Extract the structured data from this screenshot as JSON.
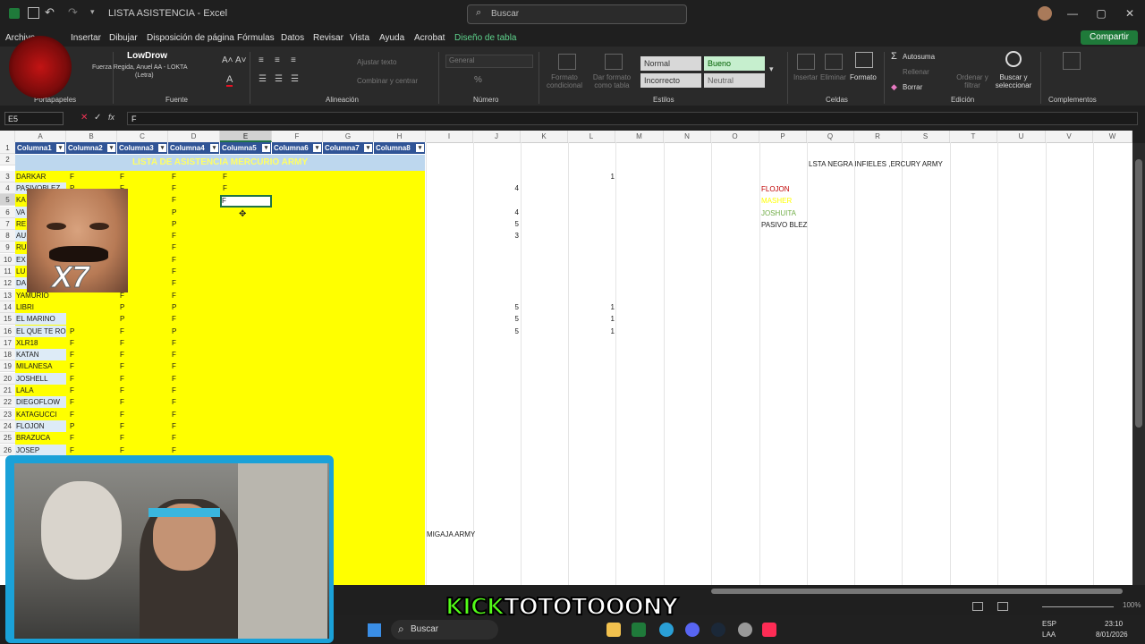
{
  "titlebar": {
    "file_title": "LISTA ASISTENCIA",
    "app_sep": "-",
    "app_name": "Excel",
    "search_placeholder": "Buscar"
  },
  "menu": {
    "items": [
      "Archivo",
      "Insertar",
      "Dibujar",
      "Disposición de página",
      "Fórmulas",
      "Datos",
      "Revisar",
      "Vista",
      "Ayuda",
      "Acrobat",
      "Diseño de tabla"
    ],
    "share_label": "Compartir"
  },
  "ribbon": {
    "groups": [
      "Portapapeles",
      "Fuente",
      "Alineación",
      "Número",
      "Estilos",
      "Celdas",
      "Edición",
      "Complementos"
    ],
    "music_title": "LowDrow",
    "music_subtitle": "Fuerza Regida, Anuel AA - LOKTA",
    "music_subtitle2": "(Letra)",
    "wrap_text": "Ajustar texto",
    "merge_center": "Combinar y centrar",
    "number_format": "General",
    "cond_format": "Formato condicional",
    "format_table": "Dar formato como tabla",
    "styles": {
      "normal": "Normal",
      "good": "Bueno",
      "bad": "Incorrecto",
      "neutral": "Neutral"
    },
    "insert": "Insertar",
    "delete": "Eliminar",
    "format": "Formato",
    "autosum": "Autosuma",
    "fill": "Rellenar",
    "clear": "Borrar",
    "sort_filter": "Ordenar y filtrar",
    "find_select": "Buscar y seleccionar"
  },
  "formula_bar": {
    "name_box": "E5",
    "formula": "F",
    "fx": "fx"
  },
  "columns": [
    "A",
    "B",
    "C",
    "D",
    "E",
    "F",
    "G",
    "H",
    "I",
    "J",
    "K",
    "L",
    "M",
    "N",
    "O",
    "P",
    "Q",
    "R",
    "S",
    "T",
    "U",
    "V",
    "W"
  ],
  "table_headers": [
    "Columna1",
    "Columna2",
    "Columna3",
    "Columna4",
    "Columna5",
    "Columna6",
    "Columna7",
    "Columna8"
  ],
  "banner": "LISTA DE ASISTENCIA MERCURIO ARMY",
  "rows": [
    {
      "n": "1"
    },
    {
      "n": "2"
    },
    {
      "n": "3",
      "name": "DARKAR",
      "b": "F",
      "c": "F",
      "d": "F",
      "e": "F",
      "l": "1"
    },
    {
      "n": "4",
      "name": "PASIVOBLEZ",
      "b": "P",
      "c": "F",
      "d": "F",
      "e": "F",
      "j": "4"
    },
    {
      "n": "5",
      "name": "KA",
      "d": "F",
      "e": "F"
    },
    {
      "n": "6",
      "name": "VA",
      "d": "P",
      "j": "4"
    },
    {
      "n": "7",
      "name": "RE",
      "d": "P",
      "j": "5"
    },
    {
      "n": "8",
      "name": "AU",
      "d": "F",
      "j": "3"
    },
    {
      "n": "9",
      "name": "RU",
      "d": "F"
    },
    {
      "n": "10",
      "name": "EX",
      "d": "F"
    },
    {
      "n": "11",
      "name": "LU",
      "d": "F"
    },
    {
      "n": "12",
      "name": "DA",
      "d": "F"
    },
    {
      "n": "13",
      "name": "YAMURIO",
      "c": "F",
      "d": "F"
    },
    {
      "n": "14",
      "name": "LIBRI",
      "c": "P",
      "d": "P",
      "j": "5",
      "l": "1"
    },
    {
      "n": "15",
      "name": "EL MARINO",
      "c": "P",
      "d": "F",
      "j": "5",
      "l": "1"
    },
    {
      "n": "16",
      "name": "EL QUE TE RO",
      "b": "P",
      "c": "F",
      "d": "P",
      "j": "5",
      "l": "1"
    },
    {
      "n": "17",
      "name": "XLR18",
      "b": "F",
      "c": "F",
      "d": "F"
    },
    {
      "n": "18",
      "name": "KATAN",
      "b": "F",
      "c": "F",
      "d": "F"
    },
    {
      "n": "19",
      "name": "MILANESA",
      "b": "F",
      "c": "F",
      "d": "F"
    },
    {
      "n": "20",
      "name": "JOSHELL",
      "b": "F",
      "c": "F",
      "d": "F"
    },
    {
      "n": "21",
      "name": "LALA",
      "b": "F",
      "c": "F",
      "d": "F"
    },
    {
      "n": "22",
      "name": "DIEGOFLOW",
      "b": "F",
      "c": "F",
      "d": "F"
    },
    {
      "n": "23",
      "name": "KATAGUCCI",
      "b": "F",
      "c": "F",
      "d": "F"
    },
    {
      "n": "24",
      "name": "FLOJON",
      "b": "P",
      "c": "F",
      "d": "F"
    },
    {
      "n": "25",
      "name": "BRAZUCA",
      "b": "F",
      "c": "F",
      "d": "F"
    },
    {
      "n": "26",
      "name": "JOSEP",
      "b": "F",
      "c": "F",
      "d": "F"
    }
  ],
  "blacklist": {
    "title": "LSTA NEGRA INFIELES ,ERCURY ARMY",
    "entries": [
      {
        "text": "FLOJON",
        "color": "#c00000"
      },
      {
        "text": "MASHER",
        "color": "#ffff00"
      },
      {
        "text": "JOSHUITA",
        "color": "#70ad47"
      },
      {
        "text": "PASIVO BLEZ",
        "color": "#222222"
      }
    ]
  },
  "migaja": "MIGAJA ARMY",
  "overlay": {
    "meme_text": "X7",
    "kick_prefix": "KICK",
    "kick_name": "TOTOTOOONY"
  },
  "status": {
    "zoom": "100%"
  },
  "taskbar": {
    "search": "Buscar",
    "lang": "ESP",
    "lang2": "LAA",
    "time": "23:10",
    "date": "8/01/2026"
  }
}
